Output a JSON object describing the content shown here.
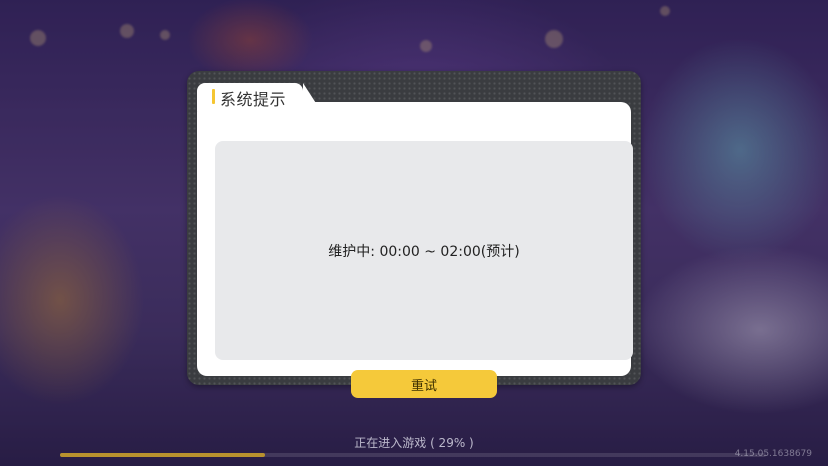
{
  "dialog": {
    "title": "系统提示",
    "message": "维护中: 00:00 ~ 02:00(预计)",
    "retry_label": "重试"
  },
  "loading": {
    "text": "正在进入游戏 ( 29% )",
    "progress": 0.29
  },
  "version": "4.15.05.1638679",
  "colors": {
    "accent": "#f5c632",
    "button": "#f5c93a",
    "progress_fill": "#b8912e"
  }
}
